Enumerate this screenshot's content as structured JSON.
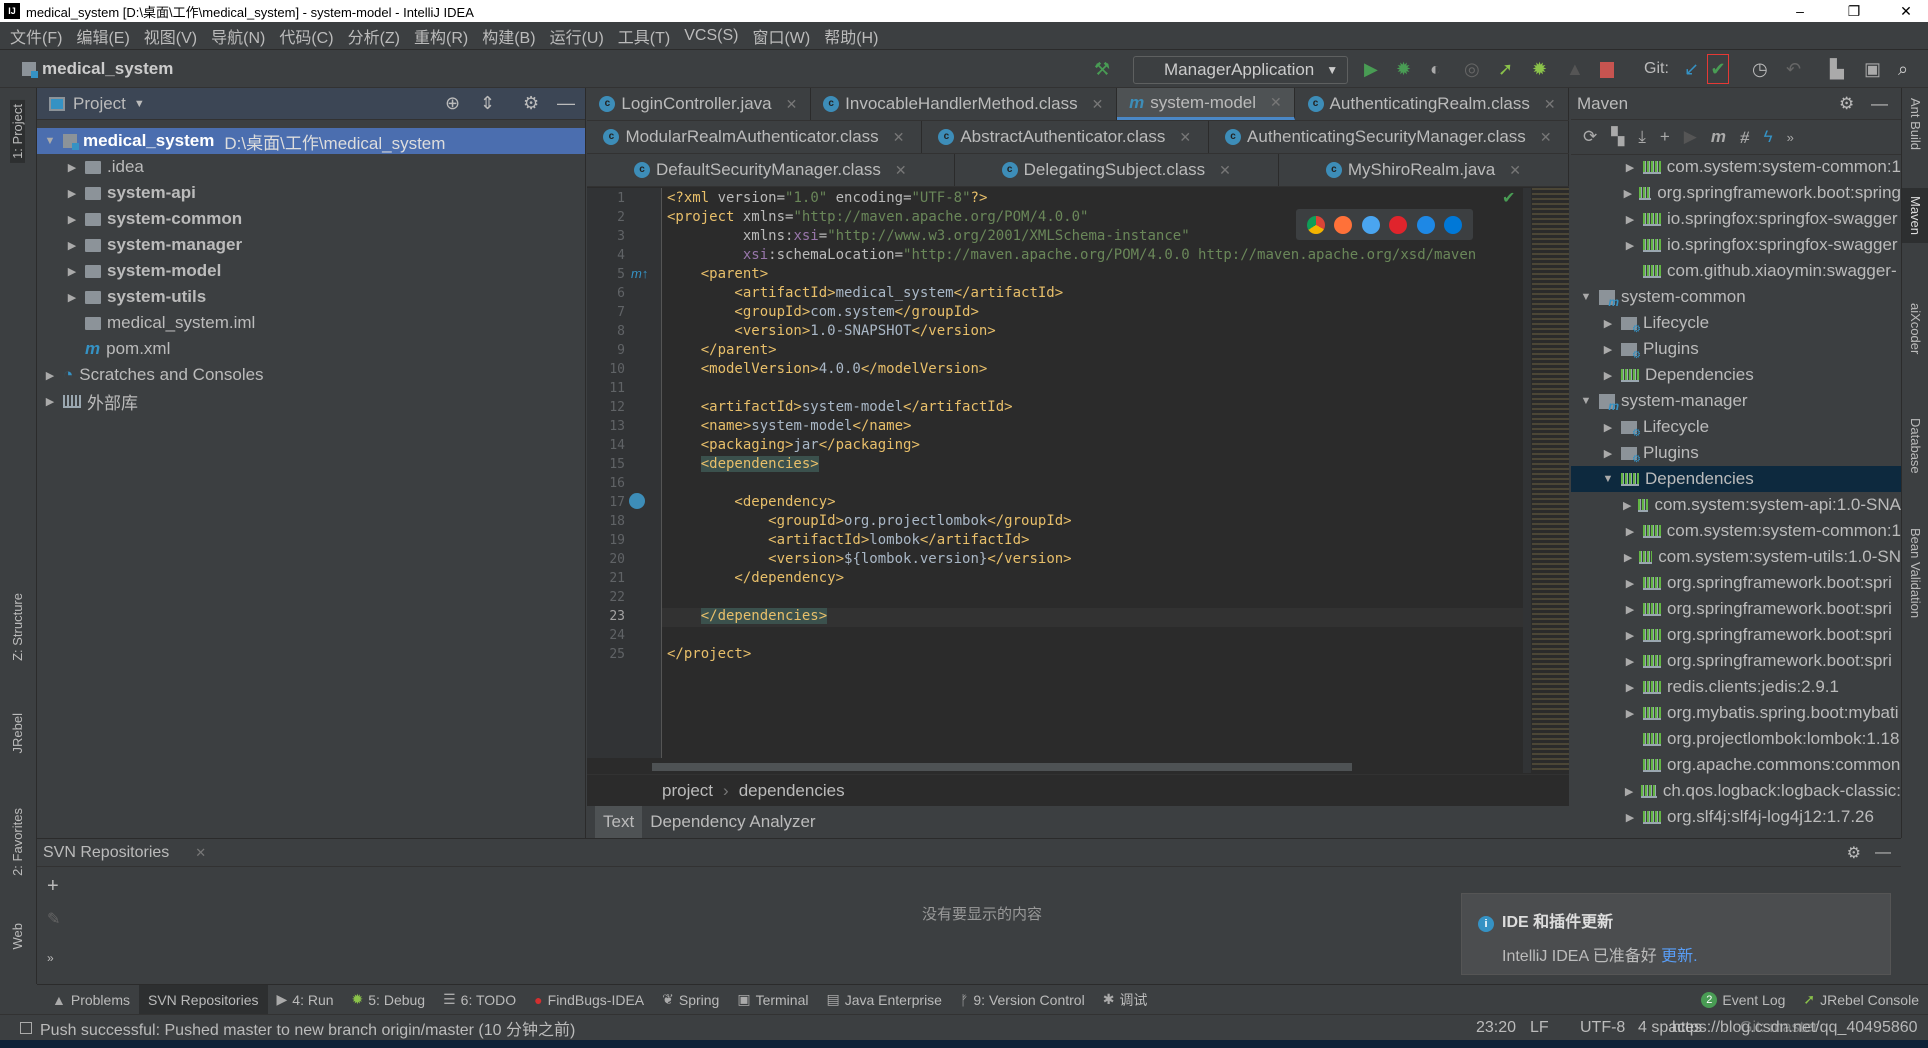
{
  "window": {
    "title": "medical_system [D:\\桌面\\工作\\medical_system] - system-model - IntelliJ IDEA",
    "logo": "IJ",
    "minimize": "–",
    "maximize": "❐",
    "close": "✕"
  },
  "menu": [
    "文件(F)",
    "编辑(E)",
    "视图(V)",
    "导航(N)",
    "代码(C)",
    "分析(Z)",
    "重构(R)",
    "构建(B)",
    "运行(U)",
    "工具(T)",
    "VCS(S)",
    "窗口(W)",
    "帮助(H)"
  ],
  "navbar": {
    "project": "medical_system",
    "run_config": "ManagerApplication",
    "git_label": "Git:"
  },
  "left_stripe": [
    "1: Project",
    "Z: Structure",
    "JRebel",
    "2: Favorites",
    "Web"
  ],
  "right_stripe": [
    "Ant Build",
    "Maven",
    "aiXcoder",
    "Database",
    "Bean Validation"
  ],
  "project_panel": {
    "title": "Project",
    "tree": [
      {
        "label": "medical_system",
        "path": "D:\\桌面\\工作\\medical_system",
        "level": 0,
        "arrow": "▼",
        "icon": "module",
        "bold": true,
        "selected": true
      },
      {
        "label": ".idea",
        "level": 1,
        "arrow": "▶",
        "icon": "folder"
      },
      {
        "label": "system-api",
        "level": 1,
        "arrow": "▶",
        "icon": "folder",
        "bold": true
      },
      {
        "label": "system-common",
        "level": 1,
        "arrow": "▶",
        "icon": "folder",
        "bold": true
      },
      {
        "label": "system-manager",
        "level": 1,
        "arrow": "▶",
        "icon": "folder",
        "bold": true
      },
      {
        "label": "system-model",
        "level": 1,
        "arrow": "▶",
        "icon": "folder",
        "bold": true
      },
      {
        "label": "system-utils",
        "level": 1,
        "arrow": "▶",
        "icon": "folder",
        "bold": true
      },
      {
        "label": "medical_system.iml",
        "level": 1,
        "arrow": "",
        "icon": "file"
      },
      {
        "label": "pom.xml",
        "level": 1,
        "arrow": "",
        "icon": "maven"
      },
      {
        "label": "Scratches and Consoles",
        "level": 0,
        "arrow": "▶",
        "icon": "scratch"
      },
      {
        "label": "外部库",
        "level": 0,
        "arrow": "▶",
        "icon": "lib"
      }
    ]
  },
  "editor": {
    "tabs": [
      [
        {
          "label": "LoginController.java",
          "icon": "c"
        },
        {
          "label": "InvocableHandlerMethod.class",
          "icon": "c"
        },
        {
          "label": "system-model",
          "icon": "m",
          "active": true
        },
        {
          "label": "AuthenticatingRealm.class",
          "icon": "c"
        }
      ],
      [
        {
          "label": "ModularRealmAuthenticator.class",
          "icon": "c"
        },
        {
          "label": "AbstractAuthenticator.class",
          "icon": "c"
        },
        {
          "label": "AuthenticatingSecurityManager.class",
          "icon": "c"
        }
      ],
      [
        {
          "label": "DefaultSecurityManager.class",
          "icon": "c"
        },
        {
          "label": "DelegatingSubject.class",
          "icon": "c"
        },
        {
          "label": "MyShiroRealm.java",
          "icon": "c"
        }
      ]
    ],
    "current_line": 23,
    "lines": [
      "<?xml version=\"1.0\" encoding=\"UTF-8\"?>",
      "<project xmlns=\"http://maven.apache.org/POM/4.0.0\"",
      "         xmlns:xsi=\"http://www.w3.org/2001/XMLSchema-instance\"",
      "         xsi:schemaLocation=\"http://maven.apache.org/POM/4.0.0 http://maven.apache.org/xsd/maven",
      "    <parent>",
      "        <artifactId>medical_system</artifactId>",
      "        <groupId>com.system</groupId>",
      "        <version>1.0-SNAPSHOT</version>",
      "    </parent>",
      "    <modelVersion>4.0.0</modelVersion>",
      "",
      "    <artifactId>system-model</artifactId>",
      "    <name>system-model</name>",
      "    <packaging>jar</packaging>",
      "    <dependencies>",
      "",
      "        <dependency>",
      "            <groupId>org.projectlombok</groupId>",
      "            <artifactId>lombok</artifactId>",
      "            <version>${lombok.version}</version>",
      "        </dependency>",
      "",
      "    </dependencies>",
      "",
      "</project>"
    ],
    "breadcrumb": [
      "project",
      "dependencies"
    ],
    "breadcrumb_sep": "›",
    "bottom_tabs": [
      "Text",
      "Dependency Analyzer"
    ]
  },
  "maven": {
    "title": "Maven",
    "tree": [
      {
        "label": "com.system:system-common:1",
        "level": 2,
        "arrow": "▶",
        "icon": "lib"
      },
      {
        "label": "org.springframework.boot:spring",
        "level": 2,
        "arrow": "▶",
        "icon": "lib"
      },
      {
        "label": "io.springfox:springfox-swagger",
        "level": 2,
        "arrow": "▶",
        "icon": "lib"
      },
      {
        "label": "io.springfox:springfox-swagger",
        "level": 2,
        "arrow": "▶",
        "icon": "lib"
      },
      {
        "label": "com.github.xiaoymin:swagger-",
        "level": 2,
        "arrow": "",
        "icon": "lib"
      },
      {
        "label": "system-common",
        "level": 0,
        "arrow": "▼",
        "icon": "module"
      },
      {
        "label": "Lifecycle",
        "level": 1,
        "arrow": "▶",
        "icon": "gear"
      },
      {
        "label": "Plugins",
        "level": 1,
        "arrow": "▶",
        "icon": "gear"
      },
      {
        "label": "Dependencies",
        "level": 1,
        "arrow": "▶",
        "icon": "deps"
      },
      {
        "label": "system-manager",
        "level": 0,
        "arrow": "▼",
        "icon": "module"
      },
      {
        "label": "Lifecycle",
        "level": 1,
        "arrow": "▶",
        "icon": "gear"
      },
      {
        "label": "Plugins",
        "level": 1,
        "arrow": "▶",
        "icon": "gear"
      },
      {
        "label": "Dependencies",
        "level": 1,
        "arrow": "▼",
        "icon": "deps",
        "selected": true
      },
      {
        "label": "com.system:system-api:1.0-SNA",
        "level": 2,
        "arrow": "▶",
        "icon": "lib"
      },
      {
        "label": "com.system:system-common:1",
        "level": 2,
        "arrow": "▶",
        "icon": "lib"
      },
      {
        "label": "com.system:system-utils:1.0-SN",
        "level": 2,
        "arrow": "▶",
        "icon": "lib"
      },
      {
        "label": "org.springframework.boot:spri",
        "level": 2,
        "arrow": "▶",
        "icon": "lib"
      },
      {
        "label": "org.springframework.boot:spri",
        "level": 2,
        "arrow": "▶",
        "icon": "lib"
      },
      {
        "label": "org.springframework.boot:spri",
        "level": 2,
        "arrow": "▶",
        "icon": "lib"
      },
      {
        "label": "org.springframework.boot:spri",
        "level": 2,
        "arrow": "▶",
        "icon": "lib"
      },
      {
        "label": "redis.clients:jedis:2.9.1",
        "level": 2,
        "arrow": "▶",
        "icon": "lib"
      },
      {
        "label": "org.mybatis.spring.boot:mybati",
        "level": 2,
        "arrow": "▶",
        "icon": "lib"
      },
      {
        "label": "org.projectlombok:lombok:1.18",
        "level": 2,
        "arrow": "",
        "icon": "lib"
      },
      {
        "label": "org.apache.commons:common",
        "level": 2,
        "arrow": "",
        "icon": "lib"
      },
      {
        "label": "ch.qos.logback:logback-classic:",
        "level": 2,
        "arrow": "▶",
        "icon": "lib"
      },
      {
        "label": "org.slf4j:slf4j-log4j12:1.7.26",
        "level": 2,
        "arrow": "▶",
        "icon": "lib"
      }
    ]
  },
  "svn": {
    "title": "SVN Repositories",
    "empty": "没有要显示的内容"
  },
  "notification": {
    "title": "IDE 和插件更新",
    "text": "IntelliJ IDEA 已准备好",
    "link": "更新."
  },
  "tool_windows": [
    {
      "label": "Problems",
      "icon": "▲"
    },
    {
      "label": "SVN Repositories",
      "active": true
    },
    {
      "label": "4: Run",
      "icon": "▶"
    },
    {
      "label": "5: Debug",
      "icon": "✹"
    },
    {
      "label": "6: TODO",
      "icon": "☰"
    },
    {
      "label": "FindBugs-IDEA",
      "icon": "●"
    },
    {
      "label": "Spring",
      "icon": "❦"
    },
    {
      "label": "Terminal",
      "icon": "▣"
    },
    {
      "label": "Java Enterprise",
      "icon": "▤"
    },
    {
      "label": "9: Version Control",
      "icon": "ᚠ"
    },
    {
      "label": "调试",
      "icon": "✱"
    }
  ],
  "tool_windows_right": [
    {
      "label": "Event Log",
      "badge": "2"
    },
    {
      "label": "JRebel Console"
    }
  ],
  "status": {
    "message": "Push successful: Pushed master to new branch origin/master (10 分钟之前)",
    "position": "23:20",
    "line_sep": "LF",
    "encoding": "UTF-8",
    "indent": "4 spaces",
    "vcs": "Git: master",
    "watermark": "https://blog.csdn.net/qq_40495860"
  },
  "colors": {
    "accent": "#4b6eaf",
    "tag": "#e8bf6a",
    "string": "#6a8759",
    "run": "#499c54",
    "stop": "#c75450"
  }
}
